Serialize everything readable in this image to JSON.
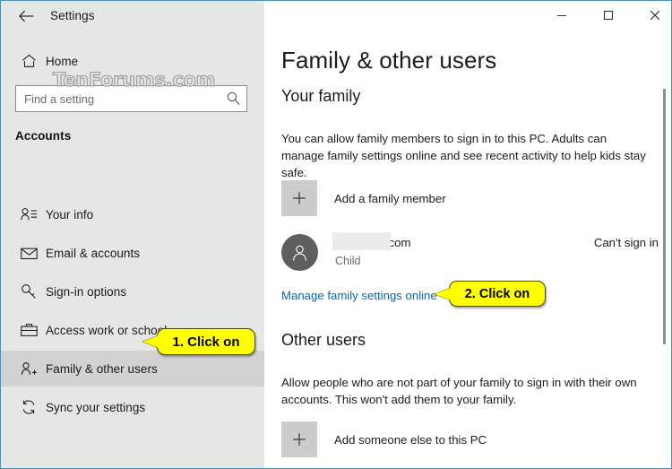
{
  "window": {
    "app_title": "Settings",
    "back_label": "Back",
    "controls": {
      "minimize": "Minimize",
      "maximize": "Maximize",
      "close": "Close"
    },
    "accent_color": "#0078d7",
    "border_color": "#4a90b8",
    "sidebar_bg": "#e6e6e6"
  },
  "watermark": {
    "text": "TenForums.com"
  },
  "sidebar": {
    "home_label": "Home",
    "search": {
      "placeholder": "Find a setting",
      "value": ""
    },
    "section_label": "Accounts",
    "items": [
      {
        "label": "Your info",
        "icon": "person-info-icon",
        "selected": false
      },
      {
        "label": "Email & accounts",
        "icon": "envelope-icon",
        "selected": false
      },
      {
        "label": "Sign-in options",
        "icon": "key-icon",
        "selected": false
      },
      {
        "label": "Access work or school",
        "icon": "briefcase-icon",
        "selected": false
      },
      {
        "label": "Family & other users",
        "icon": "person-plus-icon",
        "selected": true
      },
      {
        "label": "Sync your settings",
        "icon": "sync-icon",
        "selected": false
      }
    ]
  },
  "main": {
    "page_title": "Family & other users",
    "your_family": {
      "heading": "Your family",
      "description": "You can allow family members to sign in to this PC. Adults can manage family settings online and see recent activity to help kids stay safe.",
      "add_label": "Add a family member",
      "account": {
        "email": "@outlook.com",
        "role": "Child",
        "status": "Can't sign in"
      },
      "manage_link": "Manage family settings online"
    },
    "other_users": {
      "heading": "Other users",
      "description": "Allow people who are not part of your family to sign in with their own accounts. This won't add them to your family.",
      "add_label": "Add someone else to this PC"
    }
  },
  "callouts": [
    {
      "text": "1. Click on"
    },
    {
      "text": "2. Click on"
    }
  ]
}
